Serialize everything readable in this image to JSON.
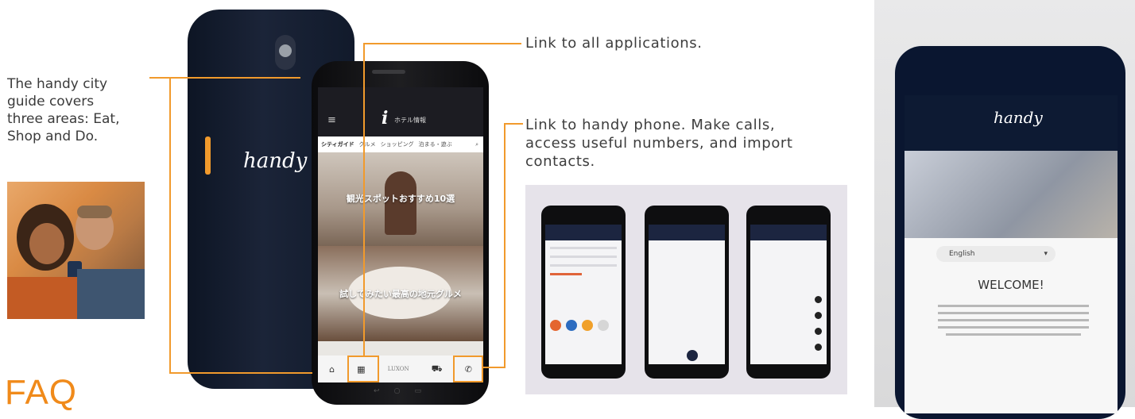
{
  "left": {
    "lines": [
      "The handy city",
      "guide covers",
      "three areas: Eat,",
      "Shop and Do."
    ],
    "faq": "FAQ"
  },
  "callouts": {
    "apps": "Link to all applications.",
    "phone_lines": [
      "Link to handy phone. Make calls,",
      "access useful numbers, and import",
      "contacts."
    ]
  },
  "phone": {
    "logo": "handy",
    "screen": {
      "header_icon": "i",
      "header_title": "ホテル情報",
      "tabs": [
        "シティガイド",
        "グルメ",
        "ショッピング",
        "泊まる・遊ぶ"
      ],
      "banner1": "観光スポットおすすめ10選",
      "banner2": "試してみたい最高の地元グルメ",
      "dock_label": "LUXON"
    }
  },
  "right_phone": {
    "language": "English",
    "welcome": "WELCOME!"
  },
  "colors": {
    "accent": "#f19a2c",
    "faq": "#f08a1a",
    "phone_body": "#1b2438"
  }
}
